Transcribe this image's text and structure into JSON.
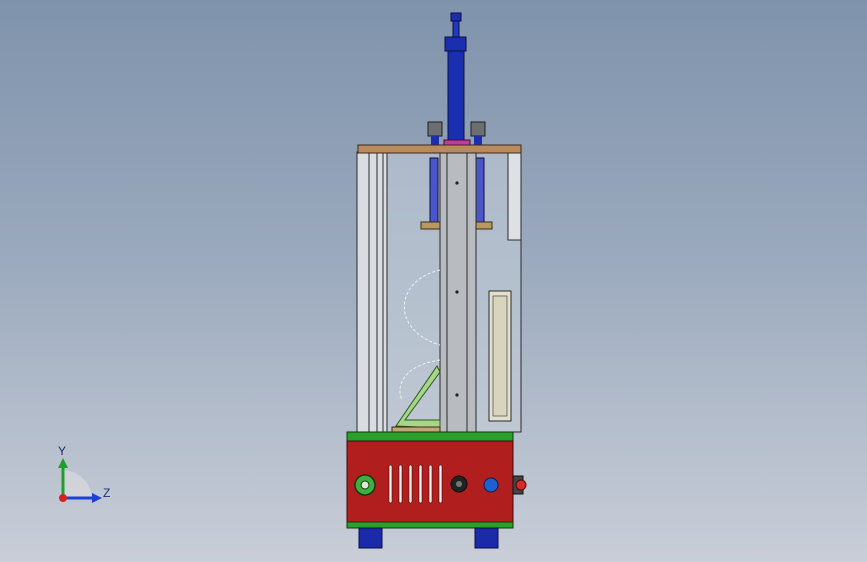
{
  "viewport": {
    "background_top": "#7f93ac",
    "background_bottom": "#c9ced8"
  },
  "triad": {
    "y_label": "Y",
    "z_label": "Z",
    "colors": {
      "y": "#1f9e2a",
      "z": "#1f3fd6",
      "x": "#d62020"
    }
  },
  "model": {
    "colors": {
      "frame": "#d9dde2",
      "glass": "#c6cfd9",
      "top_plate": "#b88a5e",
      "cylinder": "#1a2fb0",
      "column": "#b8bcc0",
      "base_body": "#b01e1e",
      "base_trim": "#2aa02a",
      "feet": "#1a2aa8",
      "support": "#a7d68a",
      "side_panel": "#e4e0cf"
    },
    "controls": [
      {
        "name": "power-switch",
        "color": "#3fae3f"
      },
      {
        "name": "selector-knob",
        "color": "#222222"
      },
      {
        "name": "indicator-lamp",
        "color": "#1f5fd0"
      },
      {
        "name": "emergency-stop",
        "color": "#d42a2a"
      }
    ],
    "vent_slots": 6
  }
}
